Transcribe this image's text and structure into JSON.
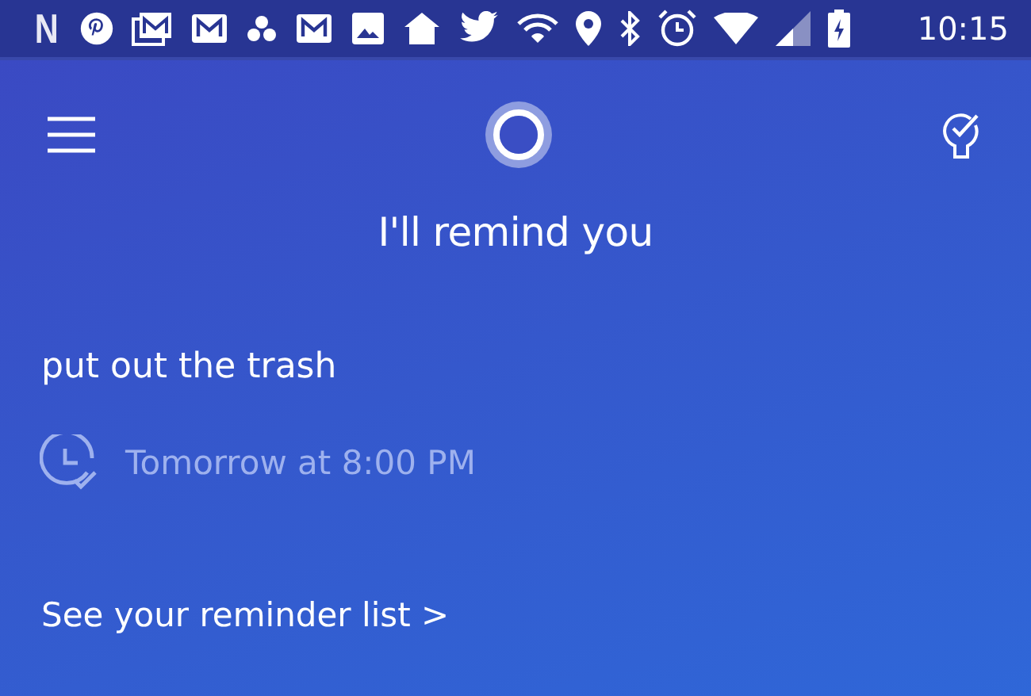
{
  "status_bar": {
    "app_letter": "N",
    "time": "10:15"
  },
  "header": {
    "title": "I'll remind you"
  },
  "reminder": {
    "text": "put out the trash",
    "when": "Tomorrow at 8:00 PM"
  },
  "link": {
    "label": "See your reminder list >"
  }
}
